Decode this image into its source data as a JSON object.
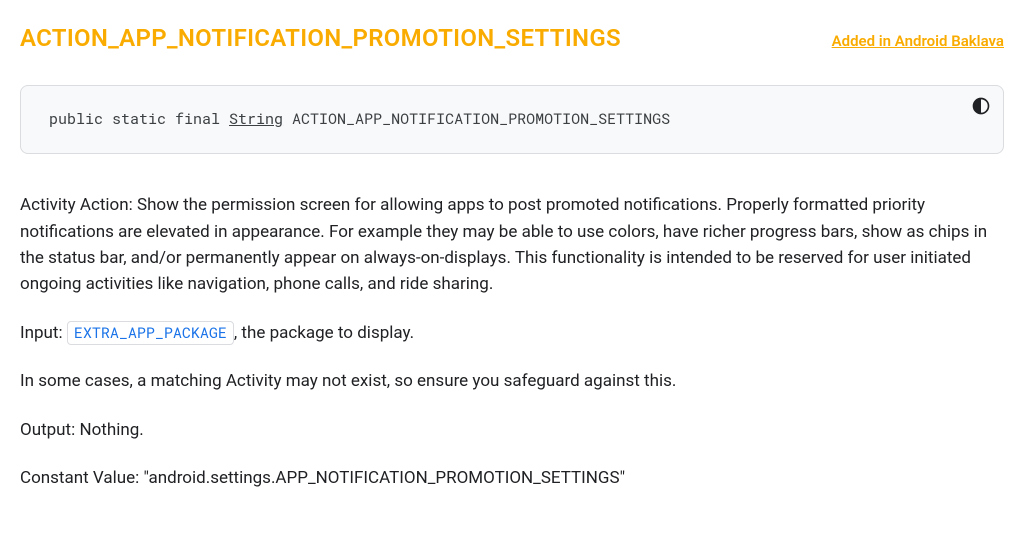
{
  "header": {
    "title": "ACTION_APP_NOTIFICATION_PROMOTION_SETTINGS",
    "added_link": "Added in Android Baklava"
  },
  "signature": {
    "modifiers": "public static final ",
    "type": "String",
    "name": " ACTION_APP_NOTIFICATION_PROMOTION_SETTINGS"
  },
  "description": {
    "main": "Activity Action: Show the permission screen for allowing apps to post promoted notifications. Properly formatted priority notifications are elevated in appearance. For example they may be able to use colors, have richer progress bars, show as chips in the status bar, and/or permanently appear on always-on-displays. This functionality is intended to be reserved for user initiated ongoing activities like navigation, phone calls, and ride sharing.",
    "input_label": "Input: ",
    "input_code": "EXTRA_APP_PACKAGE",
    "input_tail": ", the package to display.",
    "caveat": "In some cases, a matching Activity may not exist, so ensure you safeguard against this.",
    "output": "Output: Nothing.",
    "constant_value": "Constant Value: \"android.settings.APP_NOTIFICATION_PROMOTION_SETTINGS\""
  }
}
